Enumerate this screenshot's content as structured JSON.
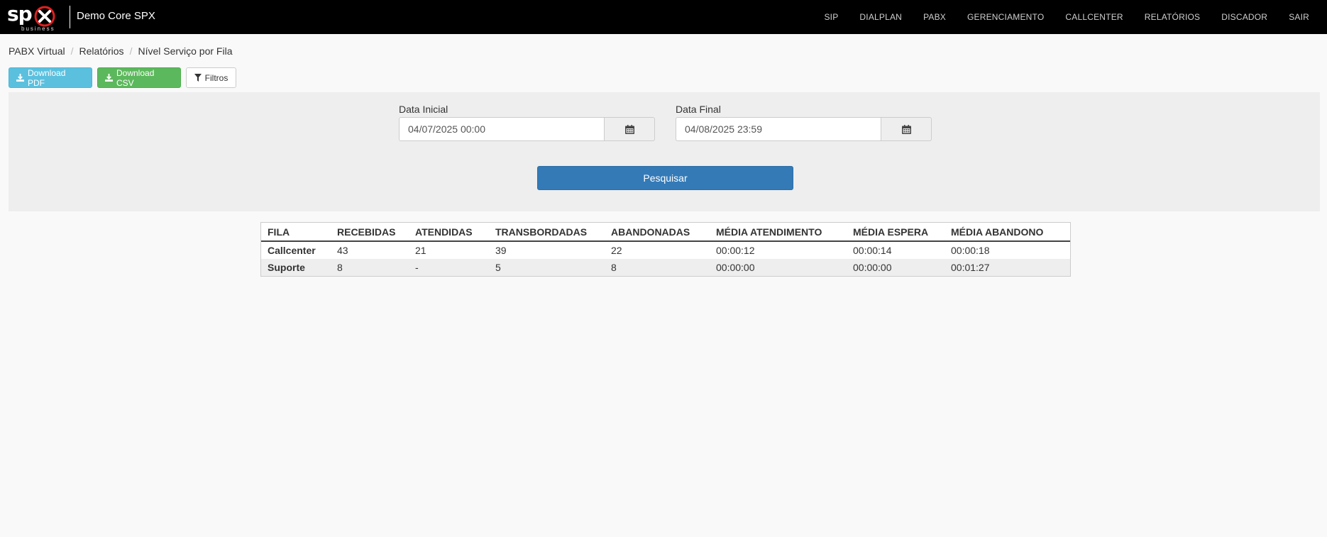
{
  "navbar": {
    "logo_text": "sp",
    "logo_sub": "business",
    "brand": "Demo Core SPX",
    "menu": [
      "SIP",
      "DIALPLAN",
      "PABX",
      "GERENCIAMENTO",
      "CALLCENTER",
      "RELATÓRIOS",
      "DISCADOR",
      "SAIR"
    ]
  },
  "breadcrumb": [
    "PABX Virtual",
    "Relatórios",
    "Nível Serviço por Fila"
  ],
  "actions": {
    "pdf": "Download PDF",
    "csv": "Download CSV",
    "filter": "Filtros"
  },
  "filters": {
    "start_label": "Data Inicial",
    "start_value": "04/07/2025 00:00",
    "end_label": "Data Final",
    "end_value": "04/08/2025 23:59",
    "search": "Pesquisar"
  },
  "table": {
    "headers": [
      "FILA",
      "RECEBIDAS",
      "ATENDIDAS",
      "TRANSBORDADAS",
      "ABANDONADAS",
      "MÉDIA ATENDIMENTO",
      "MÉDIA ESPERA",
      "MÉDIA ABANDONO"
    ],
    "rows": [
      [
        "Callcenter",
        "43",
        "21",
        "39",
        "22",
        "00:00:12",
        "00:00:14",
        "00:00:18"
      ],
      [
        "Suporte",
        "8",
        "-",
        "5",
        "8",
        "00:00:00",
        "00:00:00",
        "00:01:27"
      ]
    ]
  },
  "colors": {
    "navbar_bg": "#000000",
    "logo_accent": "#e02020",
    "btn_pdf": "#5bc0de",
    "btn_csv": "#5cb85c",
    "btn_search": "#337ab7"
  }
}
